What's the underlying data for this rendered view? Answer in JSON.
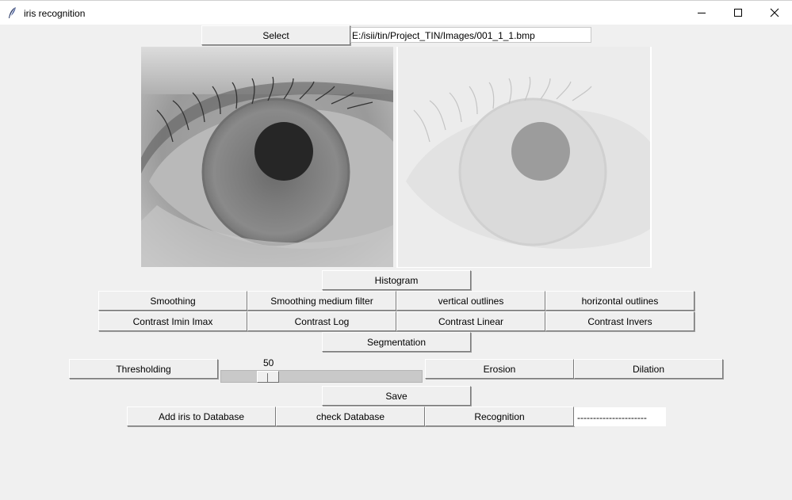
{
  "window": {
    "title": "iris recognition",
    "controls": {
      "minimize_icon": "minimize-icon",
      "maximize_icon": "maximize-icon",
      "close_icon": "close-icon"
    }
  },
  "file": {
    "select_label": "Select",
    "path_value": "E:/isii/tin/Project_TIN/Images/001_1_1.bmp"
  },
  "images": {
    "original": "eye-grayscale-image",
    "processed": "eye-processed-image"
  },
  "buttons": {
    "histogram": "Histogram",
    "smoothing": "Smoothing",
    "smoothing_median": "Smoothing medium filter",
    "vertical_outlines": "vertical outlines",
    "horizontal_outlines": "horizontal outlines",
    "contrast_imin_imax": "Contrast Imin Imax",
    "contrast_log": "Contrast Log",
    "contrast_linear": "Contrast Linear",
    "contrast_invers": "Contrast Invers",
    "segmentation": "Segmentation",
    "thresholding": "Thresholding",
    "erosion": "Erosion",
    "dilation": "Dilation",
    "save": "Save",
    "add_iris": "Add iris to Database",
    "check_database": "check Database",
    "recognition": "Recognition"
  },
  "threshold": {
    "value": "50",
    "min": 0,
    "max": 255
  },
  "recognition_result": "----------------------",
  "colors": {
    "background": "#f0f0f0",
    "titlebar": "#ffffff",
    "button": "#efefef"
  }
}
